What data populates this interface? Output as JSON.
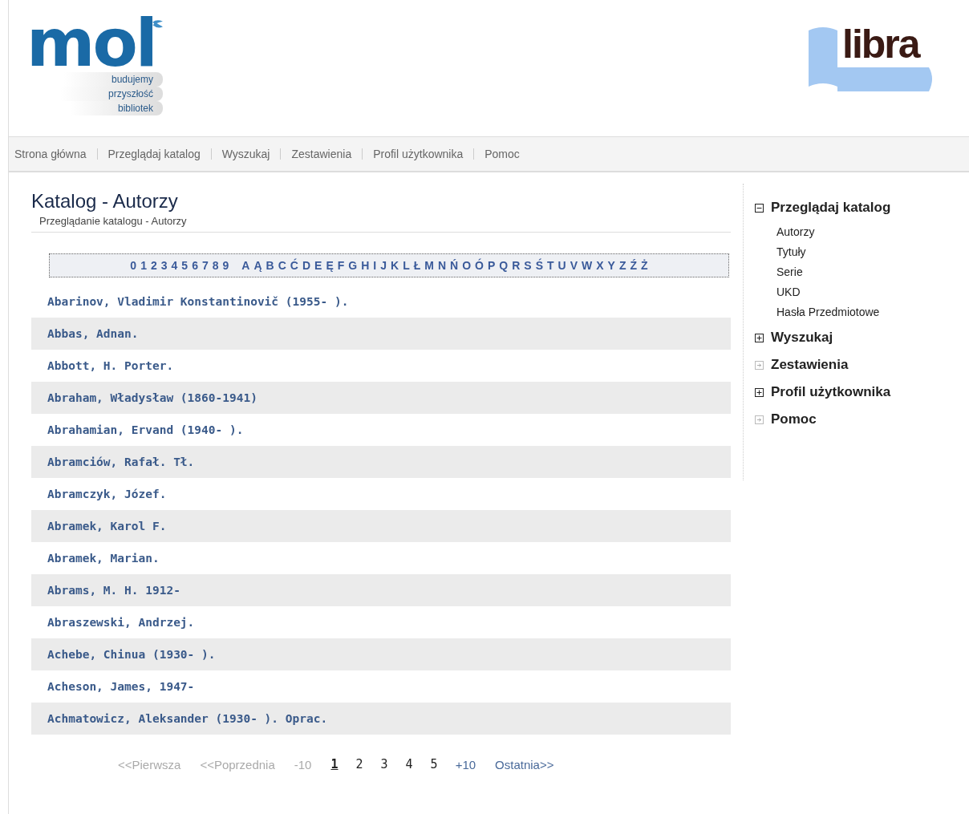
{
  "header": {
    "logo_left": {
      "text": "mol",
      "tagline": [
        "budujemy",
        "przyszłość",
        "bibliotek"
      ]
    },
    "logo_right": {
      "text": "libra"
    }
  },
  "nav": [
    "Strona główna",
    "Przeglądaj katalog",
    "Wyszukaj",
    "Zestawienia",
    "Profil użytkownika",
    "Pomoc"
  ],
  "page": {
    "title": "Katalog - Autorzy",
    "subtitle": "Przeglądanie katalogu - Autorzy"
  },
  "alphabet": {
    "digits": [
      "0",
      "1",
      "2",
      "3",
      "4",
      "5",
      "6",
      "7",
      "8",
      "9"
    ],
    "letters": [
      "A",
      "Ą",
      "B",
      "C",
      "Ć",
      "D",
      "E",
      "Ę",
      "F",
      "G",
      "H",
      "I",
      "J",
      "K",
      "L",
      "Ł",
      "M",
      "N",
      "Ń",
      "O",
      "Ó",
      "P",
      "Q",
      "R",
      "S",
      "Ś",
      "T",
      "U",
      "V",
      "W",
      "X",
      "Y",
      "Z",
      "Ź",
      "Ż"
    ]
  },
  "authors": [
    "Abarinov, Vladimir Konstantinovič (1955- ).",
    "Abbas, Adnan.",
    "Abbott, H. Porter.",
    "Abraham, Władysław (1860-1941)",
    "Abrahamian, Ervand (1940- ).",
    "Abramciów, Rafał. Tł.",
    "Abramczyk, Józef.",
    "Abramek, Karol F.",
    "Abramek, Marian.",
    "Abrams, M. H. 1912-",
    "Abraszewski, Andrzej.",
    "Achebe, Chinua (1930- ).",
    "Acheson, James, 1947-",
    "Achmatowicz, Aleksander (1930- ). Oprac."
  ],
  "pagination": [
    {
      "label": "<<Pierwsza",
      "kind": "link",
      "disabled": true,
      "selected": false
    },
    {
      "label": "<<Poprzednia",
      "kind": "link",
      "disabled": true,
      "selected": false
    },
    {
      "label": "-10",
      "kind": "link",
      "disabled": true,
      "selected": false
    },
    {
      "label": "1",
      "kind": "page",
      "disabled": false,
      "selected": true
    },
    {
      "label": "2",
      "kind": "page",
      "disabled": false,
      "selected": false
    },
    {
      "label": "3",
      "kind": "page",
      "disabled": false,
      "selected": false
    },
    {
      "label": "4",
      "kind": "page",
      "disabled": false,
      "selected": false
    },
    {
      "label": "5",
      "kind": "page",
      "disabled": false,
      "selected": false
    },
    {
      "label": "+10",
      "kind": "link",
      "disabled": false,
      "selected": false
    },
    {
      "label": "Ostatnia>>",
      "kind": "link",
      "disabled": false,
      "selected": false
    }
  ],
  "sidebar": [
    {
      "label": "Przeglądaj katalog",
      "kind": "group",
      "expanded": true,
      "children": [
        "Autorzy",
        "Tytuły",
        "Serie",
        "UKD",
        "Hasła Przedmiotowe"
      ]
    },
    {
      "label": "Wyszukaj",
      "kind": "group",
      "expanded": false
    },
    {
      "label": "Zestawienia",
      "kind": "link"
    },
    {
      "label": "Profil użytkownika",
      "kind": "group",
      "expanded": false
    },
    {
      "label": "Pomoc",
      "kind": "link"
    }
  ]
}
